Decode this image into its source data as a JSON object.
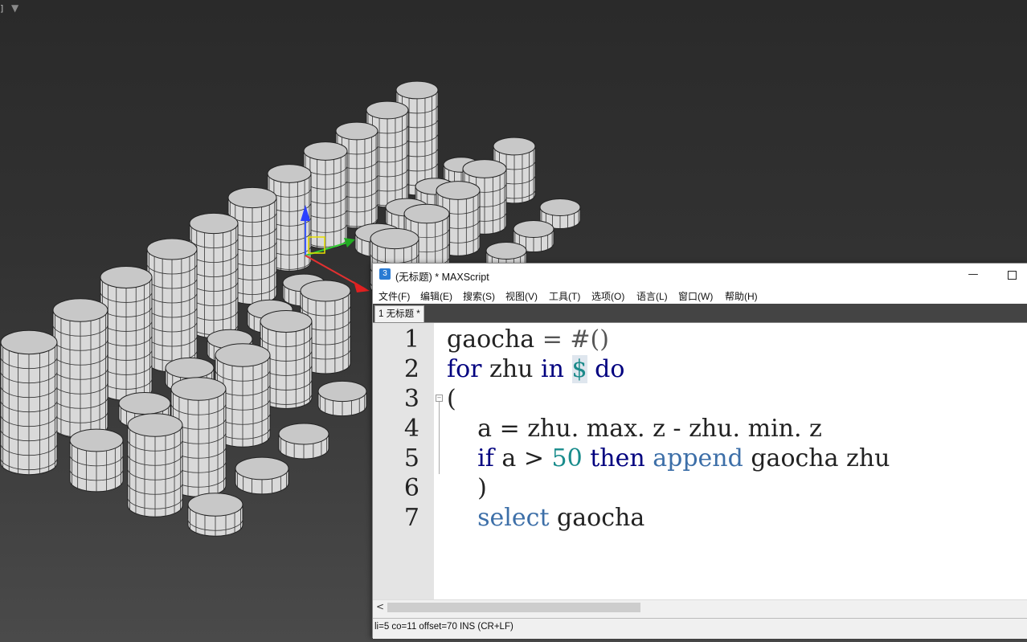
{
  "viewport": {
    "label": "]",
    "filter_icon": "filter-icon"
  },
  "editor": {
    "title": "(无标题) * MAXScript",
    "app_icon": "3",
    "min_label": "—",
    "menus": [
      "文件(F)",
      "编辑(E)",
      "搜索(S)",
      "视图(V)",
      "工具(T)",
      "选项(O)",
      "语言(L)",
      "窗口(W)",
      "帮助(H)"
    ],
    "tab_label": "1 无标题 *",
    "line_numbers": [
      "1",
      "2",
      "3",
      "4",
      "5",
      "6",
      "7"
    ],
    "code": [
      "gaocha = #()",
      "for zhu in $ do",
      "(",
      "    a = zhu.max.z - zhu.min.z",
      "    if a > 50 then append gaocha zhu",
      "    )",
      "    select gaocha"
    ],
    "tokens": {
      "l1_a": "gaocha",
      "l1_b": " = ",
      "l1_c": "#()",
      "l2_for": "for",
      "l2_var": " zhu ",
      "l2_in": "in",
      "l2_dollar": "$",
      "l2_do": "do",
      "l3": "(",
      "l4": "    a = zhu. max. z - zhu. min. z",
      "l5_if": "if",
      "l5_a": " a > ",
      "l5_num": "50",
      "l5_then": "then",
      "l5_append": "append",
      "l5_rest": " gaocha zhu",
      "l6": "    )",
      "l7_select": "select",
      "l7_rest": " gaocha"
    },
    "scroll_left": "<",
    "status": "li=5 co=11 offset=70 INS (CR+LF)"
  },
  "colors": {
    "keyword": "#00007f",
    "function": "#3d6fa8",
    "number": "#198c8c"
  }
}
